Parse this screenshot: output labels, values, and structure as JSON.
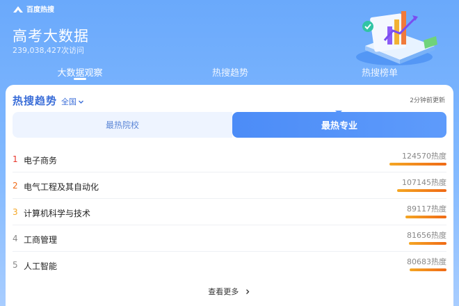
{
  "brand": {
    "name": "百度热搜"
  },
  "hero": {
    "title": "高考大数据",
    "visits": "239,038,427次访问"
  },
  "nav": {
    "tabs": [
      {
        "label": "大数据观察"
      },
      {
        "label": "热搜趋势"
      },
      {
        "label": "热搜榜单"
      }
    ],
    "active": 0
  },
  "section": {
    "title": "热搜趋势",
    "region": "全国",
    "updated": "2分钟前更新"
  },
  "segment": {
    "left_label": "最热院校",
    "right_label": "最热专业",
    "active": "right"
  },
  "ranking": {
    "items": [
      {
        "rank": "1",
        "name": "电子商务",
        "heat": "124570热度",
        "heat_value": 124570
      },
      {
        "rank": "2",
        "name": "电气工程及其自动化",
        "heat": "107145热度",
        "heat_value": 107145
      },
      {
        "rank": "3",
        "name": "计算机科学与技术",
        "heat": "89117热度",
        "heat_value": 89117
      },
      {
        "rank": "4",
        "name": "工商管理",
        "heat": "81656热度",
        "heat_value": 81656
      },
      {
        "rank": "5",
        "name": "人工智能",
        "heat": "80683热度",
        "heat_value": 80683
      }
    ],
    "rank_colors": [
      "#e8352a",
      "#f06a16",
      "#f4a623",
      "#888888",
      "#888888"
    ]
  },
  "more": {
    "label": "查看更多"
  }
}
